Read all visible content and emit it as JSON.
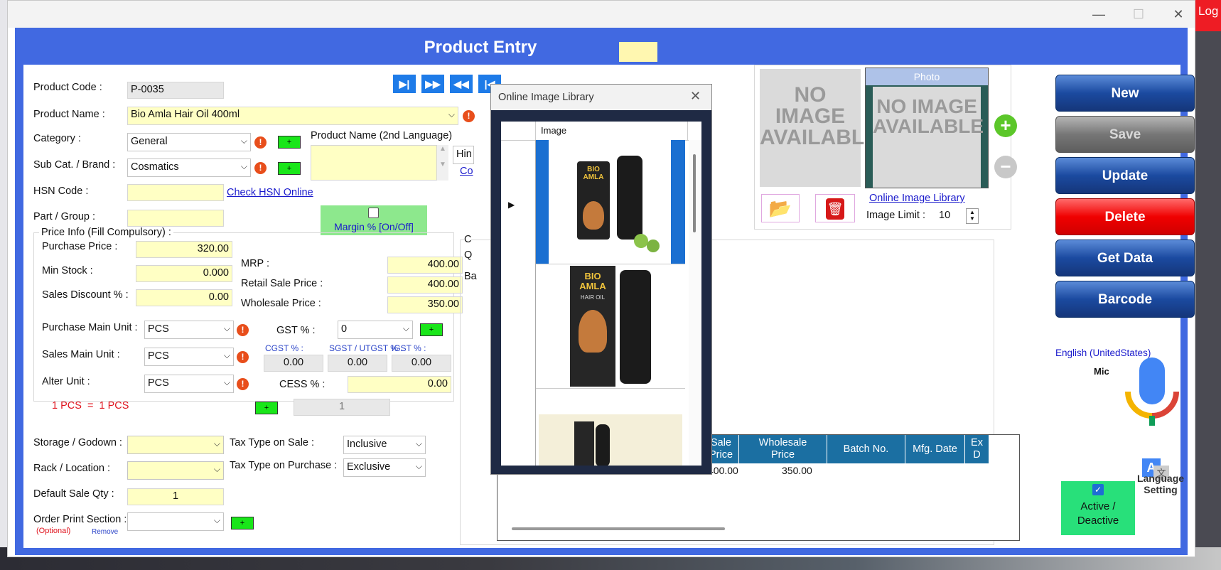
{
  "window": {
    "title": "Product Entry",
    "log_tab": "Log",
    "controls": {
      "minimize": "—",
      "maximize": "☐",
      "close": "✕"
    }
  },
  "form": {
    "product_code_label": "Product Code :",
    "product_code": "P-0035",
    "product_name_label": "Product Name :",
    "product_name": "Bio Amla Hair Oil 400ml",
    "category_label": "Category :",
    "category": "General",
    "subcat_label": "Sub Cat. / Brand :",
    "subcat": "Cosmatics",
    "hsn_label": "HSN Code :",
    "hsn": "",
    "check_hsn": "Check HSN Online",
    "part_group_label": "Part / Group :",
    "part_group": "",
    "name2_label": "Product Name (2nd Language)",
    "name2_lang": "Hin",
    "name2_link": "Co",
    "margin_toggle": "Margin % [On/Off]",
    "price_group_title": "Price Info (Fill Compulsory) :",
    "purchase_price_label": "Purchase Price :",
    "purchase_price": "320.00",
    "min_stock_label": "Min Stock :",
    "min_stock": "0.000",
    "sales_discount_label": "Sales Discount % :",
    "sales_discount": "0.00",
    "mrp_label": "MRP :",
    "mrp": "400.00",
    "retail_label": "Retail Sale Price :",
    "retail": "400.00",
    "wholesale_label": "Wholesale Price :",
    "wholesale": "350.00",
    "purchase_unit_label": "Purchase Main Unit :",
    "purchase_unit": "PCS",
    "sales_unit_label": "Sales Main Unit :",
    "sales_unit": "PCS",
    "alter_unit_label": "Alter Unit :",
    "alter_unit": "PCS",
    "unit_conversion": "1 PCS  =  1 PCS",
    "unit_factor": "1",
    "gst_label": "GST % :",
    "gst": "0",
    "cgst_label": "CGST % :",
    "cgst": "0.00",
    "sgst_label": "SGST / UTGST % :",
    "sgst": "0.00",
    "igst_label": "IGST % :",
    "igst": "0.00",
    "cess_label": "CESS % :",
    "cess": "0.00",
    "storage_label": "Storage / Godown :",
    "rack_label": "Rack / Location :",
    "default_qty_label": "Default Sale Qty :",
    "default_qty": "1",
    "order_print_label": "Order Print Section :",
    "optional": "(Optional)",
    "remove": "Remove",
    "tax_sale_label": "Tax Type on Sale :",
    "tax_sale": "Inclusive",
    "tax_purchase_label": "Tax Type on Purchase :",
    "tax_purchase": "Exclusive",
    "plus_label": "+",
    "partial_q": "Q",
    "partial_b": "Ba",
    "partial_c": "C"
  },
  "images": {
    "no_image_text": "NO IMAGE AVAILABLE",
    "photo_label": "Photo",
    "online_library_link": "Online Image Library",
    "image_limit_label": "Image Limit :",
    "image_limit": "10"
  },
  "actions": {
    "new": "New",
    "save": "Save",
    "update": "Update",
    "delete": "Delete",
    "get_data": "Get Data",
    "barcode": "Barcode"
  },
  "voice": {
    "language": "English (UnitedStates)",
    "mic": "Mic",
    "lang_setting": "Language Setting",
    "active_label": "Active / Deactive"
  },
  "dialog": {
    "title": "Online Image Library",
    "column": "Image",
    "product_brand_line1": "BIO",
    "product_brand_line2": "AMLA",
    "product_sub": "HAIR OIL"
  },
  "grid": {
    "columns": [
      "Sale\nPrice",
      "Wholesale\nPrice",
      "Batch No.",
      "Mfg. Date",
      "Ex\nD"
    ],
    "row": {
      "sale": "400.00",
      "wholesale": "350.00"
    }
  },
  "colors": {
    "window_blue": "#4169e1",
    "input_yellow": "#ffffc4",
    "green_button": "#19e619",
    "delete_red": "#f00000",
    "grid_header": "#1b6fa2"
  }
}
